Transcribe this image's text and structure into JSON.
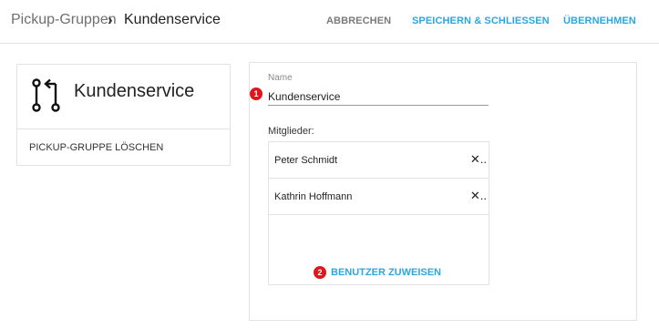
{
  "header": {
    "breadcrumb_parent": "Pickup-Gruppen",
    "breadcrumb_separator": "›",
    "breadcrumb_current": "Kundenservice",
    "cancel_label": "ABBRECHEN",
    "save_close_label": "SPEICHERN & SCHLIESSEN",
    "apply_label": "ÜBERNEHMEN"
  },
  "group_card": {
    "icon": "pickup-group-icon",
    "name": "Kundenservice",
    "delete_label": "PICKUP-GRUPPE LÖSCHEN"
  },
  "form": {
    "name_label": "Name",
    "name_value": "Kundenservice",
    "members_label": "Mitglieder:",
    "members": [
      {
        "name": "Peter Schmidt",
        "remove_icon": "close-icon"
      },
      {
        "name": "Kathrin Hoffmann",
        "remove_icon": "close-icon"
      }
    ],
    "remove_glyph": "✕..",
    "assign_label": "BENUTZER ZUWEISEN"
  },
  "annotations": {
    "badge_1": "1",
    "badge_2": "2",
    "color": "#e0161c"
  },
  "colors": {
    "accent": "#2aa7df",
    "border": "#e3e3e3"
  }
}
